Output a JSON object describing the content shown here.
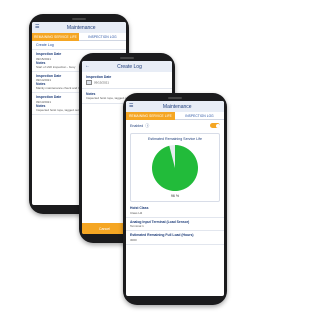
{
  "phone1": {
    "appbar": {
      "title": "Maintenance"
    },
    "tabs": {
      "active": "Remaining Service Life",
      "inactive": "Inspection Log"
    },
    "create_log": "Create Log",
    "entries": [
      {
        "date_label": "Inspection Date",
        "date": "09/15/2021",
        "notes_label": "Notes",
        "notes": "Start of shift inspection - busy"
      },
      {
        "date_label": "Inspection Date",
        "date": "09/14/2021",
        "notes_label": "Notes",
        "notes": "Mainly maintenance check and O-ring. Replaced worn parts."
      },
      {
        "date_label": "Inspection Date",
        "date": "09/13/2021",
        "notes_label": "Notes",
        "notes": "Inspected hoist rope, tagged out pending replacement."
      }
    ]
  },
  "phone2": {
    "appbar": {
      "title": "Create Log"
    },
    "date_label": "Inspection Date",
    "date": "09/15/2021",
    "notes_label": "Notes",
    "notes": "Inspected hoist rope, tagged out pending replacement.",
    "cancel": "Cancel",
    "save": "Save"
  },
  "phone3": {
    "appbar": {
      "title": "Maintenance"
    },
    "tabs": {
      "active": "Remaining Service Life",
      "inactive": "Inspection Log"
    },
    "enabled_label": "Enabled",
    "card_title": "Estimated Remaining Service Life",
    "percent": "96 %",
    "percent_value": 0.96,
    "fields": [
      {
        "label": "Hoist Class",
        "value": "Class H4"
      },
      {
        "label": "Analog Input Terminal (Load Sensor)",
        "value": "Terminal 1"
      },
      {
        "label": "Estimated Remaining Full Load (Hours)",
        "value": "3000"
      }
    ],
    "colors": {
      "gauge_fill": "#22bb3a",
      "gauge_bg": "#e6ecef",
      "accent": "#f5a623",
      "brand": "#1e4ba0"
    }
  }
}
